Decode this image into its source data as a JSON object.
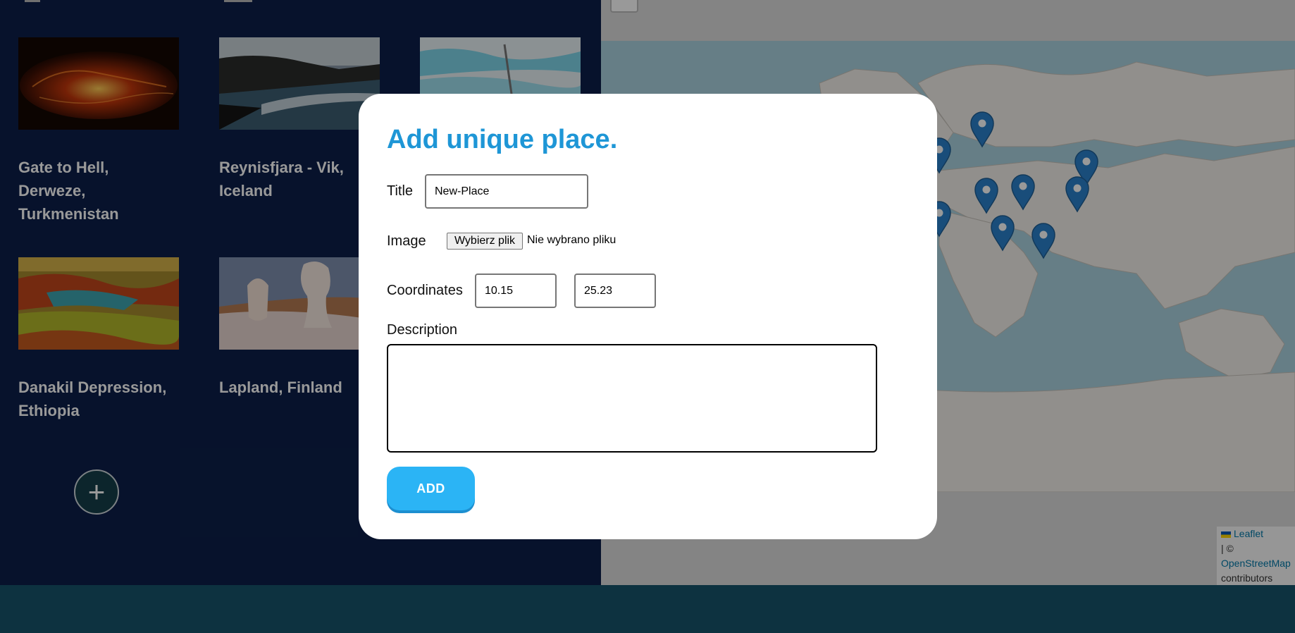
{
  "places": [
    {
      "title": "Gate to Hell, Derweze, Turkmenistan",
      "image": "lava-crater-photo"
    },
    {
      "title": "Reynisfjara - Vik, Iceland",
      "image": "black-sand-beach-photo"
    },
    {
      "title": "",
      "image": "white-terraces-photo"
    },
    {
      "title": "Danakil Depression, Ethiopia",
      "image": "colorful-salt-flats-photo"
    },
    {
      "title": "Lapland, Finland",
      "image": "snowy-trees-photo"
    }
  ],
  "add_place_symbol": "+",
  "map": {
    "marker_icon": "map-marker-icon",
    "marker_count": 8,
    "attribution": {
      "leaflet": "Leaflet",
      "separator": "| ©",
      "osm": "OpenStreetMap",
      "contributors": "contributors"
    }
  },
  "modal": {
    "heading": "Add unique place.",
    "title_label": "Title",
    "title_value": "New-Place",
    "image_label": "Image",
    "file_button": "Wybierz plik",
    "file_status": "Nie wybrano pliku",
    "coordinates_label": "Coordinates",
    "lat_value": "10.15",
    "lng_value": "25.23",
    "description_label": "Description",
    "description_value": "",
    "add_button": "ADD"
  },
  "colors": {
    "accent": "#1e96d6",
    "button": "#2bb4f5",
    "panel": "#0c1f4a",
    "footer": "#0d3240",
    "marker": "#2a81cb"
  }
}
